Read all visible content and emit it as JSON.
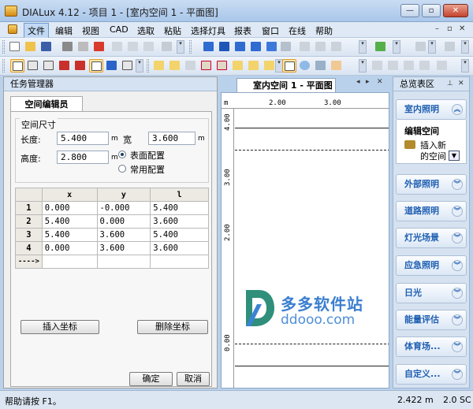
{
  "window": {
    "title": "DIALux 4.12 - 项目 1 - [室内空间 1 - 平面图]",
    "controls": [
      "—",
      "▫",
      "✕"
    ]
  },
  "menu": {
    "items": [
      "文件",
      "编辑",
      "视图",
      "CAD",
      "选取",
      "粘贴",
      "选择灯具",
      "报表",
      "窗口",
      "在线",
      "帮助"
    ],
    "mdi_controls": [
      "–",
      "▫",
      "✕"
    ]
  },
  "task_manager": {
    "title": "任务管理器",
    "tab": "空间编辑员",
    "room_size": {
      "title": "空间尺寸",
      "length_label": "长度:",
      "length_value": "5.400",
      "length_unit": "m",
      "width_label": "宽",
      "width_value": "3.600",
      "width_unit": "m",
      "height_label": "高度:",
      "height_value": "2.800",
      "height_unit": "m",
      "option_surface": "表面配置",
      "option_common": "常用配置",
      "selected_option": "表面配置"
    },
    "table": {
      "headers": [
        "",
        "x",
        "y",
        "l"
      ],
      "rows": [
        {
          "idx": "1",
          "x": "0.000",
          "y": "-0.000",
          "l": "5.400"
        },
        {
          "idx": "2",
          "x": "5.400",
          "y": "0.000",
          "l": "3.600"
        },
        {
          "idx": "3",
          "x": "5.400",
          "y": "3.600",
          "l": "5.400"
        },
        {
          "idx": "4",
          "x": "0.000",
          "y": "3.600",
          "l": "3.600"
        }
      ],
      "new_row_marker": "---->"
    },
    "insert_coord_btn": "插入坐标",
    "delete_coord_btn": "删除坐标",
    "ok_btn": "确定",
    "cancel_btn": "取消"
  },
  "document": {
    "tab_title": "室内空间 1 - 平面图",
    "ruler_unit": "m",
    "ruler_top_labels": [
      "2.00",
      "3.00"
    ],
    "ruler_left_labels": [
      "4.00",
      "3.00",
      "2.00",
      "0.00"
    ]
  },
  "overview": {
    "title": "总览表区",
    "categories": [
      {
        "label": "室内照明",
        "expanded": true
      },
      {
        "label": "外部照明"
      },
      {
        "label": "道路照明"
      },
      {
        "label": "灯光场景"
      },
      {
        "label": "应急照明"
      },
      {
        "label": "日光"
      },
      {
        "label": "能量评估"
      },
      {
        "label": "体育场..."
      },
      {
        "label": "自定义..."
      }
    ],
    "edit_space_label": "编辑空间",
    "insert_new_label": "插入新",
    "space_label": "的空间"
  },
  "status": {
    "help": "帮助请按 F1。",
    "coordinate": "2.422 m",
    "scale": "2.0 SC"
  },
  "watermark": {
    "cn": "多多软件站",
    "url": "ddooo.com"
  },
  "colors": {
    "accent": "#1f5fb1",
    "titlebar": "#a9c6ea",
    "selected_toolbar": "#ffe7a8"
  }
}
